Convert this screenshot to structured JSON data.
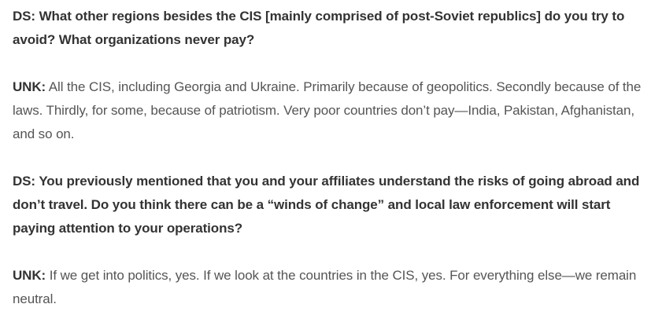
{
  "interview": [
    {
      "type": "question",
      "speaker": "DS:",
      "text": "What other regions besides the CIS [mainly comprised of post-Soviet republics] do you try to avoid? What organizations never pay?"
    },
    {
      "type": "answer",
      "speaker": "UNK:",
      "text": "All the CIS, including Georgia and Ukraine. Primarily because of geopolitics. Secondly because of the laws. Thirdly, for some, because of patriotism. Very poor countries don’t pay—India, Pakistan, Afghanistan, and so on."
    },
    {
      "type": "question",
      "speaker": "DS:",
      "text": "You previously mentioned that you and your affiliates understand the risks of going abroad and don’t travel. Do you think there can be a “winds of change” and local law enforcement will start paying attention to your operations?"
    },
    {
      "type": "answer",
      "speaker": "UNK:",
      "text": "If we get into politics, yes. If we look at the countries in the CIS, yes. For everything else—we remain neutral."
    }
  ]
}
